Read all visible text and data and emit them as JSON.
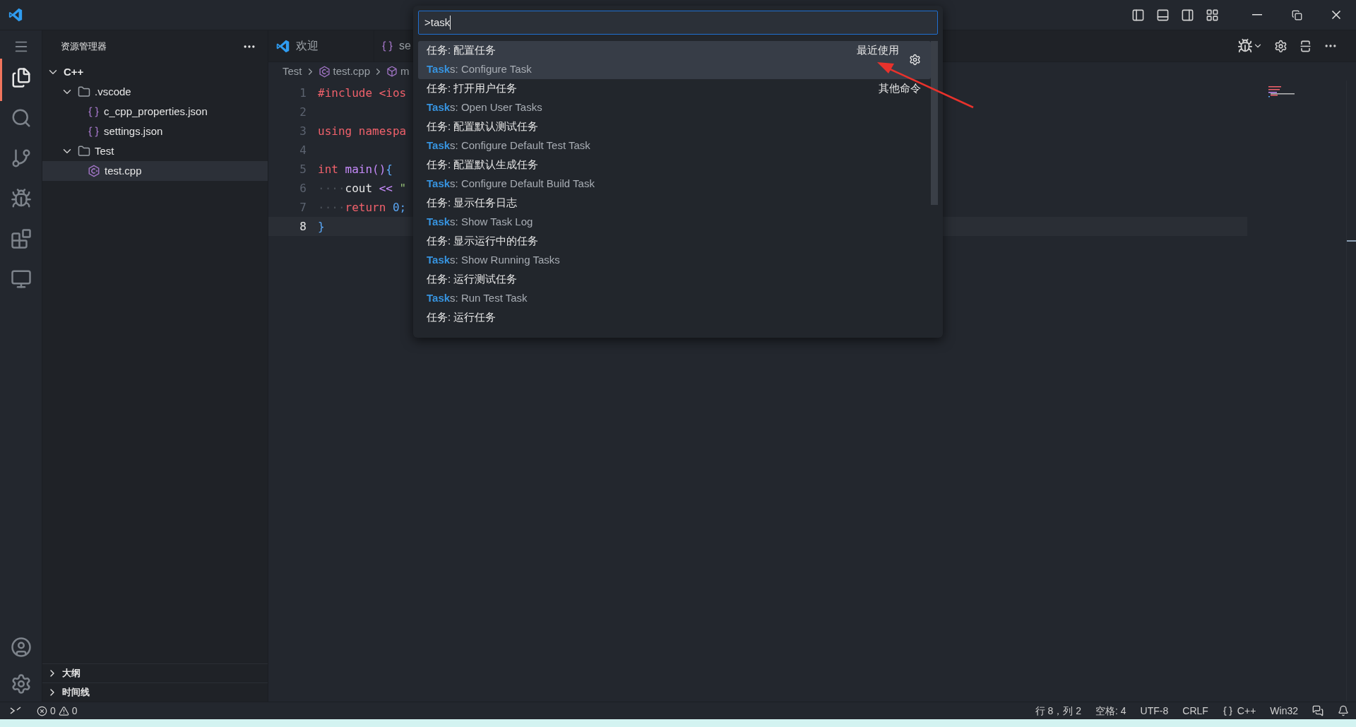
{
  "explorer": {
    "title": "资源管理器",
    "tree": [
      {
        "label": "C++",
        "kind": "root",
        "expanded": true,
        "selected": false,
        "children": [
          {
            "label": ".vscode",
            "kind": "folder",
            "expanded": true,
            "selected": false,
            "children": [
              {
                "label": "c_cpp_properties.json",
                "kind": "json",
                "selected": false
              },
              {
                "label": "settings.json",
                "kind": "json",
                "selected": false
              }
            ]
          },
          {
            "label": "Test",
            "kind": "folder",
            "expanded": true,
            "selected": false,
            "children": [
              {
                "label": "test.cpp",
                "kind": "cpp",
                "selected": true
              }
            ]
          }
        ]
      }
    ],
    "sections": [
      {
        "label": "大纲",
        "expanded": false
      },
      {
        "label": "时间线",
        "expanded": false
      }
    ]
  },
  "tabs": [
    {
      "label": "欢迎",
      "kind": "welcome",
      "selected": false
    },
    {
      "label": "se",
      "kind": "json",
      "selected": false
    }
  ],
  "breadcrumb": [
    {
      "label": "Test",
      "kind": "folder"
    },
    {
      "label": "test.cpp",
      "kind": "cpp"
    },
    {
      "label": "m",
      "kind": "symbol"
    }
  ],
  "code": [
    {
      "number": "1",
      "current": false,
      "tokens": [
        {
          "text": "#include <ios",
          "kind": "kw"
        }
      ]
    },
    {
      "number": "2",
      "current": false
    },
    {
      "number": "3",
      "current": false,
      "tokens": [
        {
          "text": "using namespa",
          "kind": "kw"
        }
      ]
    },
    {
      "number": "4",
      "current": false
    },
    {
      "number": "5",
      "current": false,
      "tokens": [
        {
          "text": "int",
          "kind": "kw"
        },
        {
          "text": " main",
          "kind": "fn"
        },
        {
          "text": "()",
          "kind": "fn"
        },
        {
          "text": "{",
          "kind": "brace"
        }
      ]
    },
    {
      "number": "6",
      "current": false,
      "tokens": [
        {
          "text": "····",
          "kind": "ws"
        },
        {
          "text": "cout",
          "kind": "plain"
        },
        {
          "text": " <<",
          "kind": "op"
        },
        {
          "text": " \"",
          "kind": "str"
        }
      ]
    },
    {
      "number": "7",
      "current": false,
      "tokens": [
        {
          "text": "····",
          "kind": "ws"
        },
        {
          "text": "return",
          "kind": "kw"
        },
        {
          "text": " 0;",
          "kind": "num"
        }
      ]
    },
    {
      "number": "8",
      "current": true,
      "tokens": [
        {
          "text": "}",
          "kind": "brace"
        }
      ]
    }
  ],
  "palette": {
    "value": ">task",
    "items": [
      {
        "label": "任务: 配置任务",
        "match": "Task",
        "rest": "s: Configure Task",
        "tag": "最近使用",
        "selected": true
      },
      {
        "label": "任务: 打开用户任务",
        "match": "Task",
        "rest": "s: Open User Tasks",
        "tag": "其他命令",
        "selected": false
      },
      {
        "label": "任务: 配置默认测试任务",
        "match": "Task",
        "rest": "s: Configure Default Test Task",
        "selected": false
      },
      {
        "label": "任务: 配置默认生成任务",
        "match": "Task",
        "rest": "s: Configure Default Build Task",
        "selected": false
      },
      {
        "label": "任务: 显示任务日志",
        "match": "Task",
        "rest": "s: Show Task Log",
        "selected": false
      },
      {
        "label": "任务: 显示运行中的任务",
        "match": "Task",
        "rest": "s: Show Running Tasks",
        "selected": false
      },
      {
        "label": "任务: 运行测试任务",
        "match": "Task",
        "rest": "s: Run Test Task",
        "selected": false
      },
      {
        "label": "任务: 运行任务",
        "selected": false
      }
    ]
  },
  "status_bar": {
    "errors": "0",
    "warnings": "0",
    "items": [
      {
        "text": "行 8，列 2",
        "kind": "text"
      },
      {
        "text": "空格: 4",
        "kind": "text"
      },
      {
        "text": "UTF-8",
        "kind": "text"
      },
      {
        "text": "CRLF",
        "kind": "text"
      },
      {
        "text": "C++",
        "kind": "language"
      },
      {
        "text": "Win32",
        "kind": "text"
      }
    ]
  }
}
